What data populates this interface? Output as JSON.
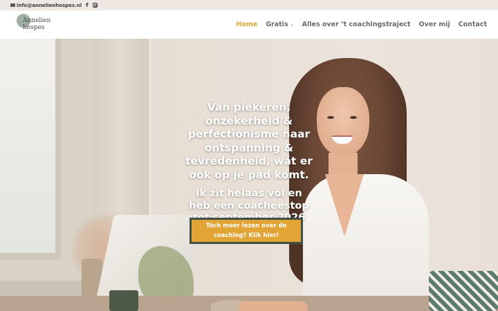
{
  "topbar": {
    "email": "info@annelienhospes.nl",
    "icons": [
      "mail-icon",
      "facebook-icon",
      "instagram-icon"
    ],
    "facebook_glyph": "f"
  },
  "header": {
    "logo_text": "Annelien hospes",
    "nav": [
      {
        "label": "Home",
        "active": true
      },
      {
        "label": "Gratis",
        "has_dropdown": true
      },
      {
        "label": "Alles over ’t coachingstraject"
      },
      {
        "label": "Over mij"
      },
      {
        "label": "Contact"
      }
    ]
  },
  "hero": {
    "heading": "Van piekeren, onzekerheid & perfectionisme naar ontspanning & tevredenheid, wát er ook op je pad komt.",
    "subheading": "Ik zit helaas vol en heb een coacheestop tot september 2026",
    "cta_label": "Tóch meer lezen over de coaching? Klik hier!"
  },
  "colors": {
    "accent": "#e0a537",
    "button_bg": "#e2a434",
    "button_border": "#3f4f44",
    "topbar_bg": "#efe7e1",
    "nav_text": "#6a6a6a"
  }
}
